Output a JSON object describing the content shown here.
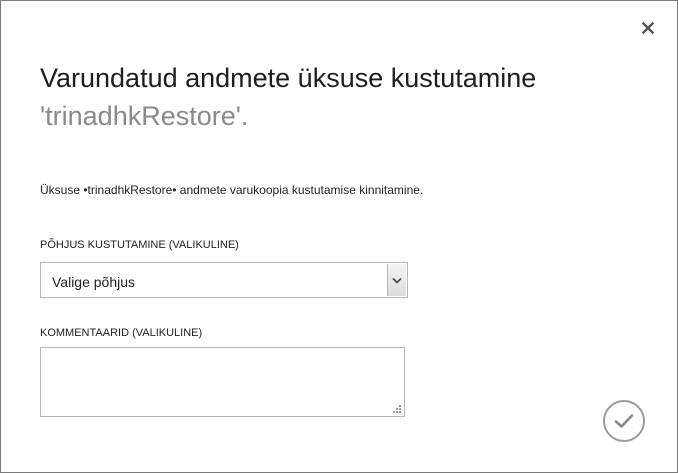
{
  "dialog": {
    "title_line1": "Varundatud andmete üksuse kustutamine",
    "title_line2": "'trinadhkRestore'.",
    "description": "Üksuse •trinadhkRestore• andmete varukoopia kustutamise kinnitamine.",
    "reason": {
      "label": "PÕHJUS KUSTUTAMINE (VALIKULINE)",
      "selected": "Valige põhjus"
    },
    "comments": {
      "label": "KOMMENTAARID (VALIKULINE)",
      "value": ""
    },
    "icons": {
      "close": "close-icon",
      "dropdown": "chevron-down-icon",
      "confirm": "checkmark-icon",
      "resize": "resize-grip-icon"
    },
    "colors": {
      "title": "#1e1e1e",
      "title_secondary": "#8a8a8a",
      "border": "#b5b5b5",
      "confirm_ring": "#9c9c9c"
    }
  }
}
